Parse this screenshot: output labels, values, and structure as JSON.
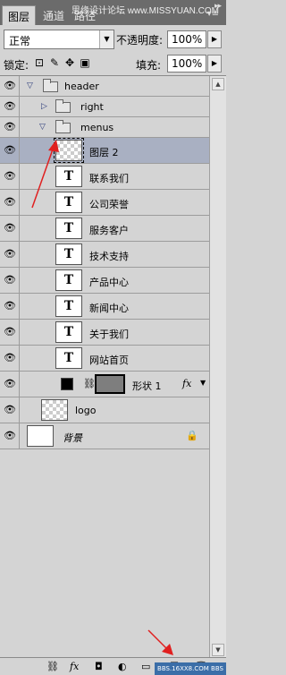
{
  "tabs": [
    {
      "label": "图层",
      "active": true
    },
    {
      "label": "通道",
      "active": false
    },
    {
      "label": "路径",
      "active": false
    }
  ],
  "watermark": "思缘设计论坛 www.MISSYUAN.COM",
  "blend_mode": "正常",
  "opacity": {
    "label": "不透明度:",
    "value": "100%"
  },
  "lock_label": "锁定:",
  "fill": {
    "label": "填充:",
    "value": "100%"
  },
  "layers": [
    {
      "name": "header",
      "type": "group-open",
      "indent": 0
    },
    {
      "name": "right",
      "type": "group-closed",
      "indent": 1
    },
    {
      "name": "menus",
      "type": "group-open",
      "indent": 1
    },
    {
      "name": "图层 2",
      "type": "pixel",
      "indent": 2,
      "selected": true
    },
    {
      "name": "联系我们",
      "type": "text",
      "indent": 2
    },
    {
      "name": "公司荣誉",
      "type": "text",
      "indent": 2
    },
    {
      "name": "服务客户",
      "type": "text",
      "indent": 2
    },
    {
      "name": "技术支持",
      "type": "text",
      "indent": 2
    },
    {
      "name": "产品中心",
      "type": "text",
      "indent": 2
    },
    {
      "name": "新闻中心",
      "type": "text",
      "indent": 2
    },
    {
      "name": "关于我们",
      "type": "text",
      "indent": 2
    },
    {
      "name": "网站首页",
      "type": "text",
      "indent": 2
    },
    {
      "name": "形状 1",
      "type": "shape",
      "indent": 2,
      "fx": "fx"
    },
    {
      "name": "logo",
      "type": "pixel",
      "indent": 1
    },
    {
      "name": "背景",
      "type": "background",
      "indent": 0
    }
  ],
  "text_thumb_glyph": "T",
  "bottom_brand": "BBS.16XX8.COM BBS",
  "icons": {
    "visibility": "eye-icon",
    "link": "link-icon",
    "fx": "fx",
    "mask": "mask-icon",
    "adjust": "adjustment-icon",
    "newgroup": "folder-icon",
    "newlayer": "new-layer-icon",
    "trash": "trash-icon"
  },
  "colors": {
    "selected_row": "#a9b0c2",
    "panel_bg": "#d4d4d4",
    "tab_bg": "#6b6b6b",
    "annotation_arrow": "#e02020"
  }
}
